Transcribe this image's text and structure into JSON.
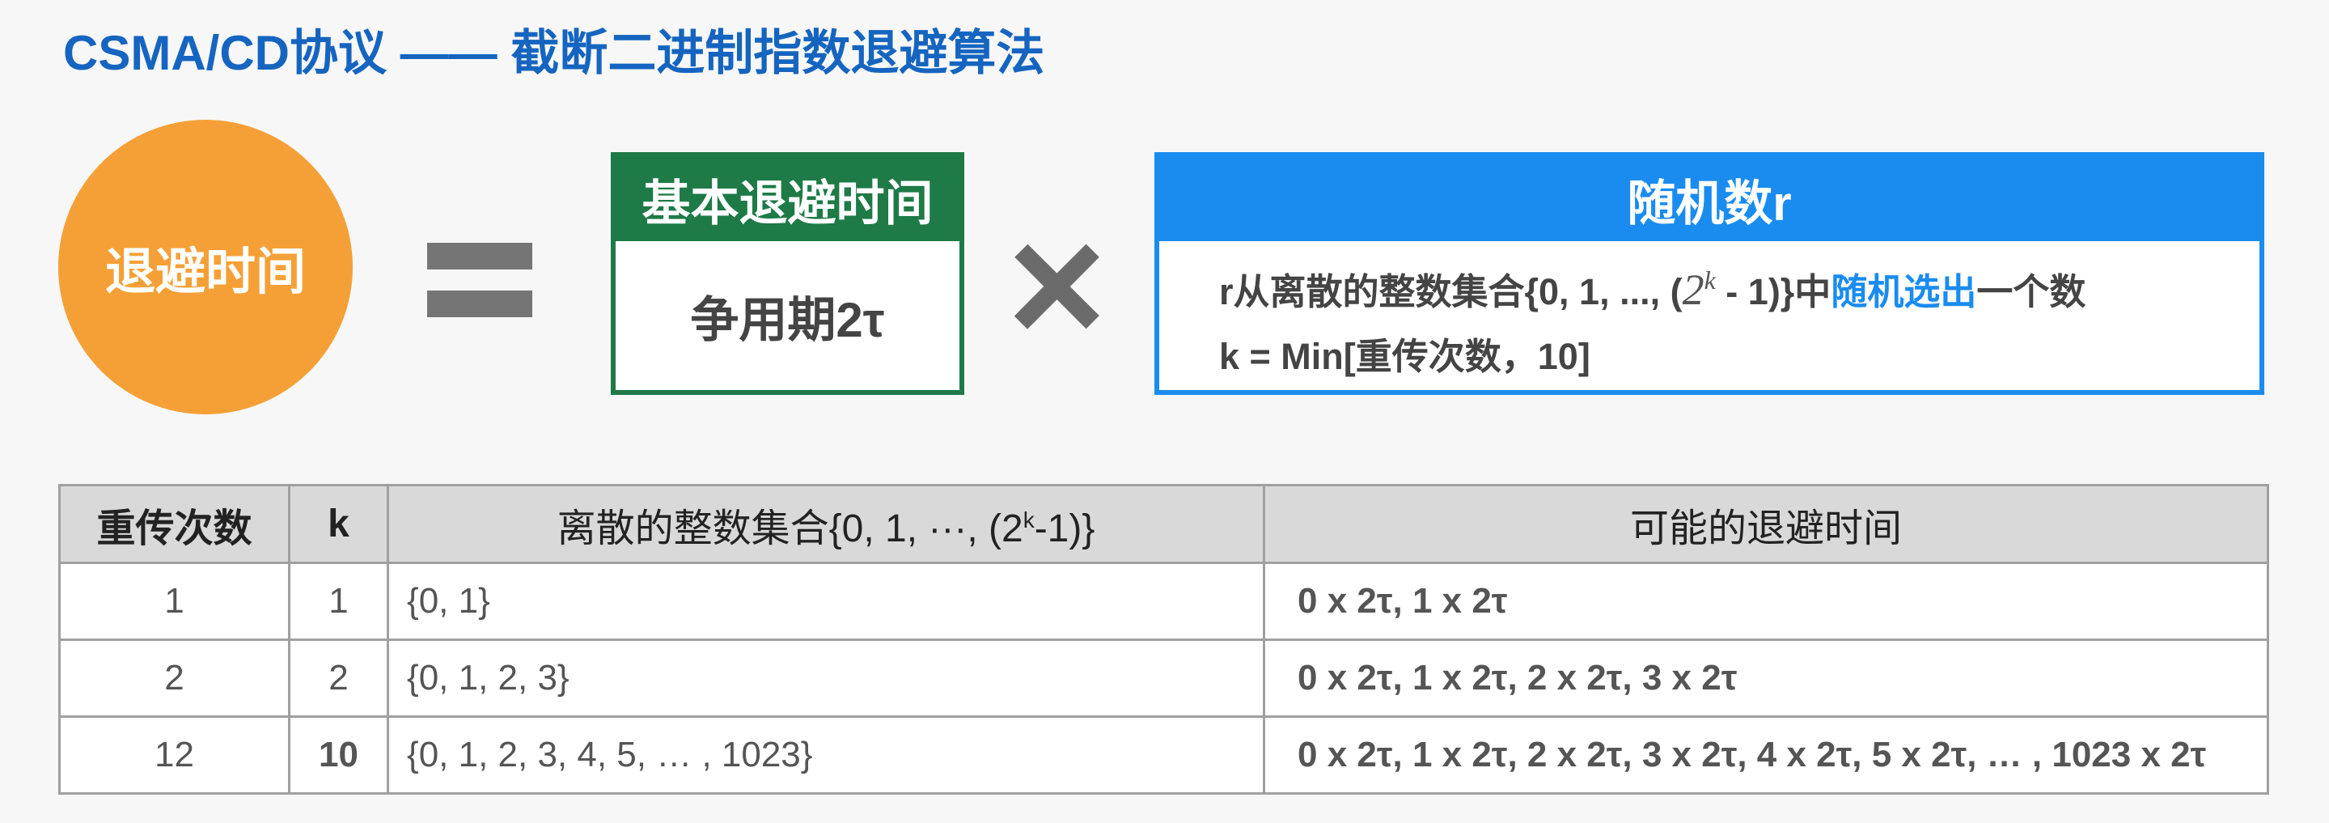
{
  "title": "CSMA/CD协议 —— 截断二进制指数退避算法",
  "circle": {
    "label": "退避时间"
  },
  "green_box": {
    "header": "基本退避时间",
    "body": "争用期2τ"
  },
  "blue_box": {
    "header": "随机数r",
    "line1_prefix": "r从离散的整数集合{0, 1, ..., (",
    "line1_base": "2",
    "line1_exp": "k",
    "line1_after": " - 1)}中",
    "line1_highlight": "随机选出",
    "line1_suffix": "一个数",
    "line2": "k = Min[重传次数，10]"
  },
  "table": {
    "headers": {
      "retries": "重传次数",
      "k": "k",
      "set_prefix": "离散的整数集合{0, 1, ···, (2",
      "set_exp": "k",
      "set_suffix": "-1)}",
      "times": "可能的退避时间"
    },
    "rows": [
      {
        "retries": "1",
        "k": "1",
        "set": "{0, 1}",
        "times": "0 x 2τ,  1 x 2τ"
      },
      {
        "retries": "2",
        "k": "2",
        "set": "{0, 1, 2, 3}",
        "times": "0 x 2τ,  1 x 2τ, 2 x 2τ, 3 x 2τ"
      },
      {
        "retries": "12",
        "k": "10",
        "set": "{0, 1, 2, 3, 4, 5, … , 1023}",
        "times": "0 x 2τ,  1 x 2τ, 2 x 2τ, 3 x 2τ, 4 x 2τ, 5 x 2τ, … , 1023 x 2τ"
      }
    ]
  },
  "colors": {
    "title": "#1565c0",
    "circle": "#f5a037",
    "green": "#1e7a47",
    "blue": "#1a8cf0",
    "highlight_k": "#d0281e"
  }
}
